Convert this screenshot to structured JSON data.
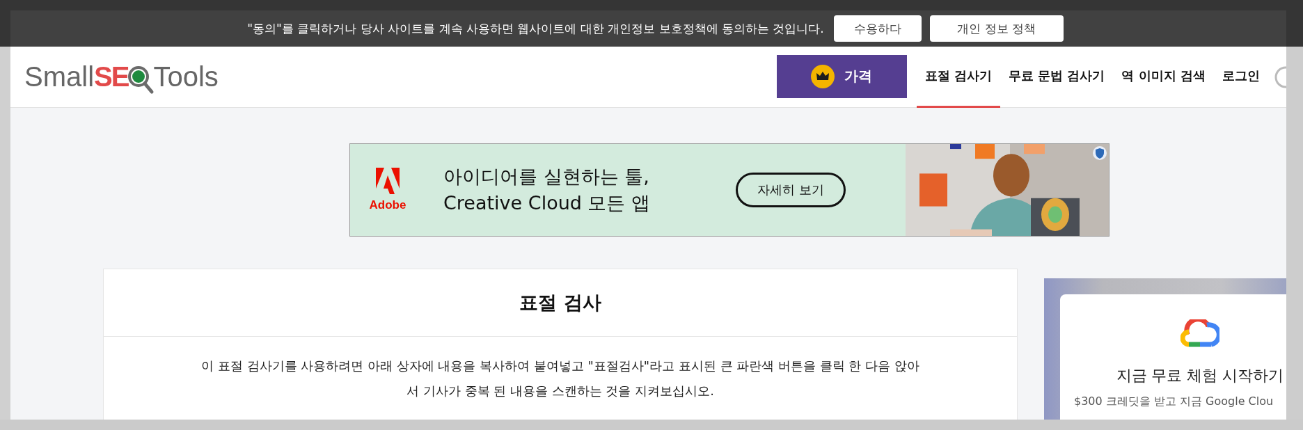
{
  "consent_bar": {
    "message": "\"동의\"를 클릭하거나 당사 사이트를 계속 사용하면 웹사이트에 대한 개인정보 보호정책에 동의하는 것입니다.",
    "buttons": [
      "수용하다",
      "개인 정보 정책"
    ]
  },
  "header": {
    "logo": {
      "before": "Small",
      "highlight": "SE",
      "after": "Tools"
    },
    "price_button": {
      "label": "가격"
    },
    "nav": [
      {
        "label": "표절 검사기",
        "selected": true
      },
      {
        "label": "무료 문법 검사기",
        "selected": false
      },
      {
        "label": "역 이미지 검색",
        "selected": false
      },
      {
        "label": "로그인",
        "selected": false
      }
    ]
  },
  "ad_banner": {
    "brand": "Adobe",
    "headline_lines": [
      "아이디어를 실현하는 툴,",
      "Creative Cloud 모든 앱"
    ],
    "button": "자세히 보기"
  },
  "main_card": {
    "title": "표절 검사",
    "description": "이 표절 검사기를 사용하려면 아래 상자에 내용을 복사하여 붙여넣고 \"표절검사\"라고 표시된 큰 파란색 버튼을 클릭 한 다음 앉아서 기사가 중복 된 내용을 스캔하는 것을 지켜보십시오."
  },
  "side_ad": {
    "title": "지금 무료 체험 시작하기",
    "text": "$300 크레딧을 받고 지금 Google Clou"
  }
}
